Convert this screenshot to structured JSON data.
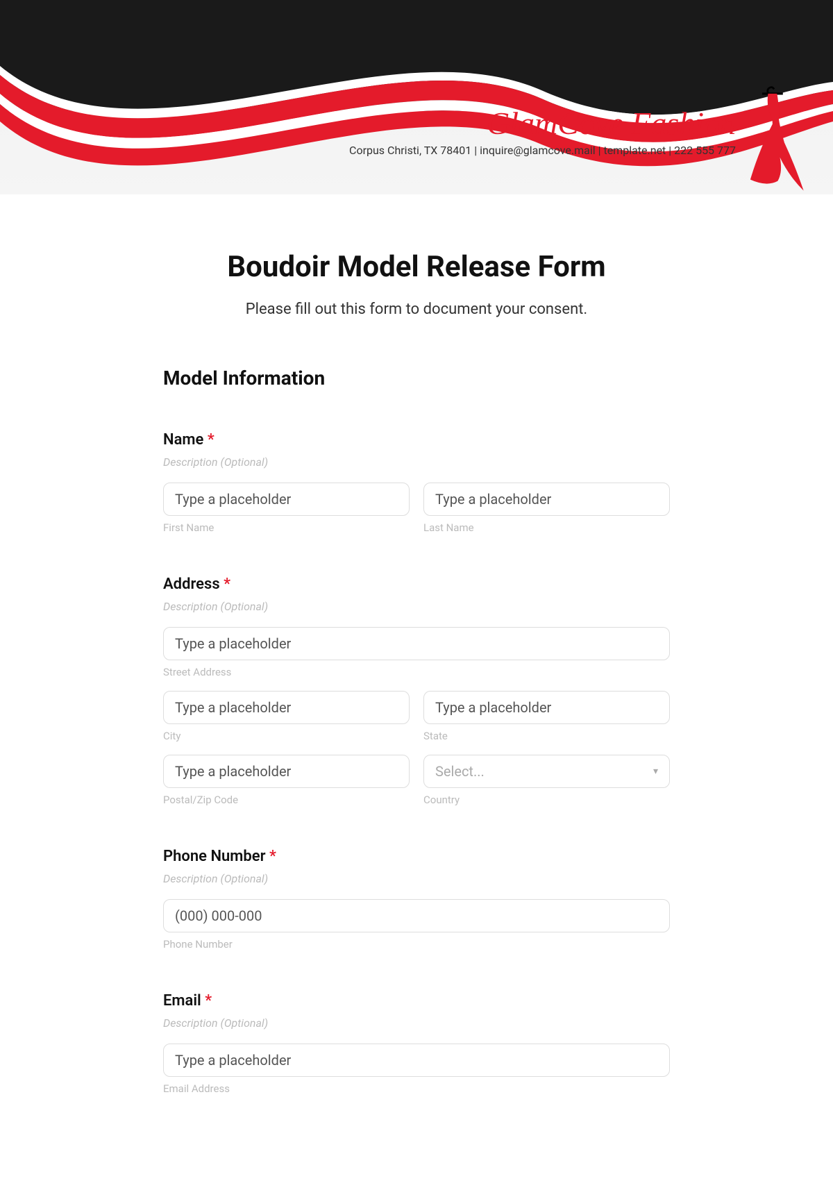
{
  "header": {
    "brand_name": "GlamCove Fashion",
    "contact": "Corpus Christi, TX 78401 | inquire@glamcove.mail | template.net | 222 555 777"
  },
  "form": {
    "title": "Boudoir Model Release Form",
    "subtitle": "Please fill out this form to document your consent.",
    "section_title": "Model Information",
    "desc_placeholder": "Description (Optional)",
    "required_mark": "*",
    "name": {
      "label": "Name",
      "first_placeholder": "Type a placeholder",
      "last_placeholder": "Type a placeholder",
      "first_sub": "First Name",
      "last_sub": "Last Name"
    },
    "address": {
      "label": "Address",
      "street_placeholder": "Type a placeholder",
      "street_sub": "Street Address",
      "city_placeholder": "Type a placeholder",
      "city_sub": "City",
      "state_placeholder": "Type a placeholder",
      "state_sub": "State",
      "postal_placeholder": "Type a placeholder",
      "postal_sub": "Postal/Zip Code",
      "country_placeholder": "Select...",
      "country_sub": "Country"
    },
    "phone": {
      "label": "Phone Number",
      "placeholder": "(000) 000-000",
      "sub": "Phone Number"
    },
    "email": {
      "label": "Email",
      "placeholder": "Type a placeholder",
      "sub": "Email Address"
    }
  }
}
